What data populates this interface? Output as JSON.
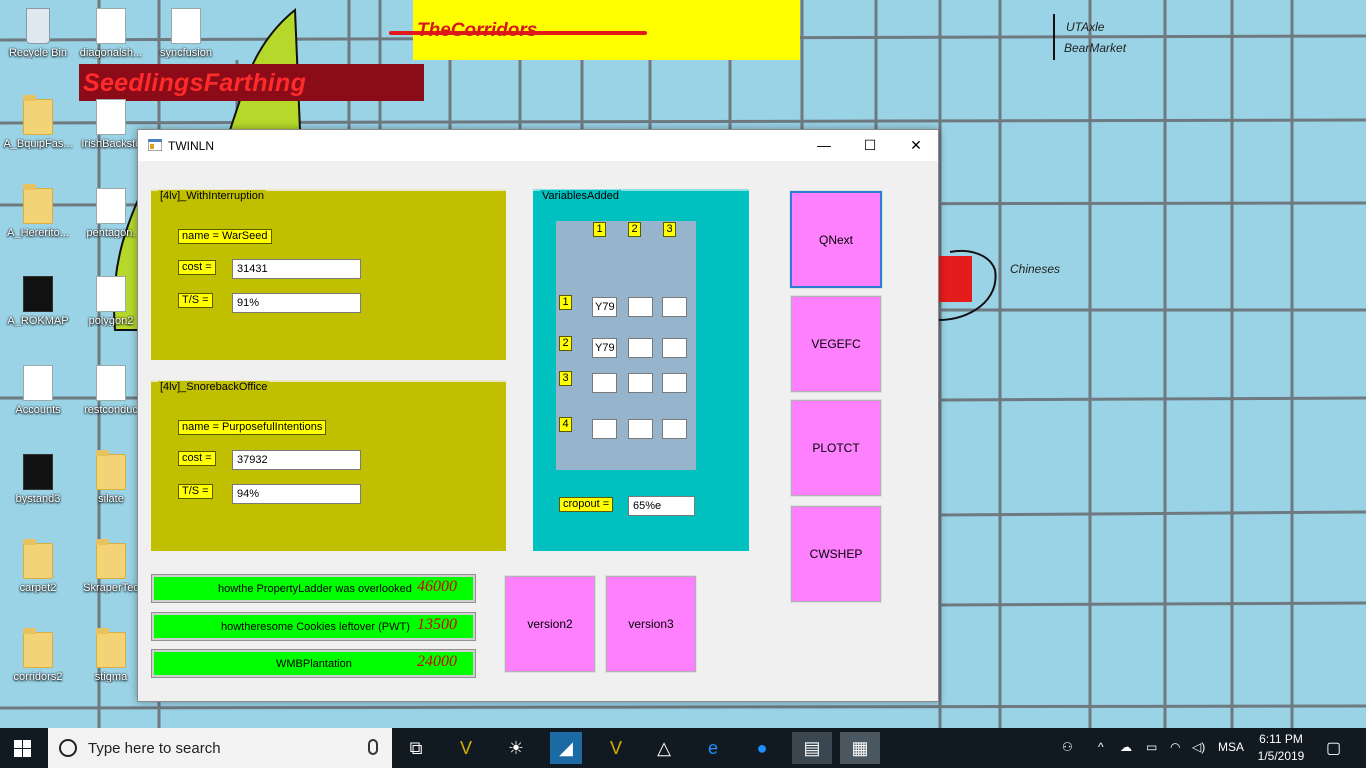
{
  "desktop": {
    "icons": [
      {
        "label": "Recycle Bin",
        "icon": "recycle-bin-icon"
      },
      {
        "label": "diagonalsh...",
        "icon": "document-icon"
      },
      {
        "label": "syncfusion",
        "icon": "document-icon"
      },
      {
        "label": "A_BquipFas...",
        "icon": "folder-icon"
      },
      {
        "label": "IrishBackstc",
        "icon": "document-icon"
      },
      {
        "label": "A_Hererito...",
        "icon": "folder-icon"
      },
      {
        "label": "pentagon.",
        "icon": "document-icon"
      },
      {
        "label": "A_ROKMAP",
        "icon": "document-icon"
      },
      {
        "label": "polygon2",
        "icon": "document-icon"
      },
      {
        "label": "Accounts",
        "icon": "document-icon"
      },
      {
        "label": "restconduc",
        "icon": "document-icon"
      },
      {
        "label": "bystand3",
        "icon": "document-icon"
      },
      {
        "label": "silate",
        "icon": "folder-icon"
      },
      {
        "label": "carpet2",
        "icon": "folder-icon"
      },
      {
        "label": "SkraperTec",
        "icon": "folder-icon"
      },
      {
        "label": "corridors2",
        "icon": "folder-icon"
      },
      {
        "label": "stigma",
        "icon": "folder-icon"
      }
    ],
    "banner_yellow": "TheCorridors",
    "banner_red": "SeedlingsFarthing",
    "map_labels": {
      "utaxle": "UTAxle",
      "bearmarket": "BearMarket",
      "chineses": "Chineses"
    },
    "colors": {
      "desktop": "#9ad3e6",
      "grid": "#6e7a80"
    }
  },
  "window": {
    "title": "TWINLN",
    "controls": {
      "minimize": "—",
      "maximize": "☐",
      "close": "✕"
    },
    "group1": {
      "legend": "[4lv]_WithInterruption",
      "name_label": "name = WarSeed",
      "cost_label": "cost =",
      "cost_value": "31431",
      "ts_label": "T/S =",
      "ts_value": "91%"
    },
    "group2": {
      "legend": "[4lv]_SnorebackOffice",
      "name_label": "name = PurposefulIntentions",
      "cost_label": "cost =",
      "cost_value": "37932",
      "ts_label": "T/S =",
      "ts_value": "94%"
    },
    "variables": {
      "legend": "VariablesAdded",
      "col_headers": [
        "1",
        "2",
        "3"
      ],
      "row_headers": [
        "1",
        "2",
        "3",
        "4"
      ],
      "cells": [
        [
          "Y79",
          "",
          ""
        ],
        [
          "Y79",
          "",
          ""
        ],
        [
          "",
          "",
          ""
        ],
        [
          "",
          "",
          ""
        ]
      ],
      "cropout_label": "cropout =",
      "cropout_value": "65%e"
    },
    "side_buttons": [
      "QNext",
      "VEGEFC",
      "PLOTCT",
      "CWSHEP"
    ],
    "version_buttons": [
      "version2",
      "version3"
    ],
    "green_bars": [
      {
        "text": "howthe PropertyLadder was overlooked",
        "value": "46000"
      },
      {
        "text": "howtheresome Cookies leftover (PWT)",
        "value": "13500"
      },
      {
        "text": "WMBPlantation",
        "value": "24000"
      }
    ],
    "colors": {
      "group": "#c0c000",
      "variables": "#00c0c0",
      "grid_panel": "#97b4cd",
      "pink": "#ff80ff",
      "green": "#00ff00"
    }
  },
  "taskbar": {
    "search_placeholder": "Type here to search",
    "apps": [
      "task-view-icon",
      "vectorworks-icon",
      "bulb-icon",
      "triangle-app-icon",
      "vectorworks2-icon",
      "delta-icon",
      "edge-icon",
      "chat-icon",
      "doc-app-icon",
      "form-app-icon"
    ],
    "tray": {
      "language": "MSA",
      "time": "6:11 PM",
      "date": "1/5/2019"
    }
  }
}
